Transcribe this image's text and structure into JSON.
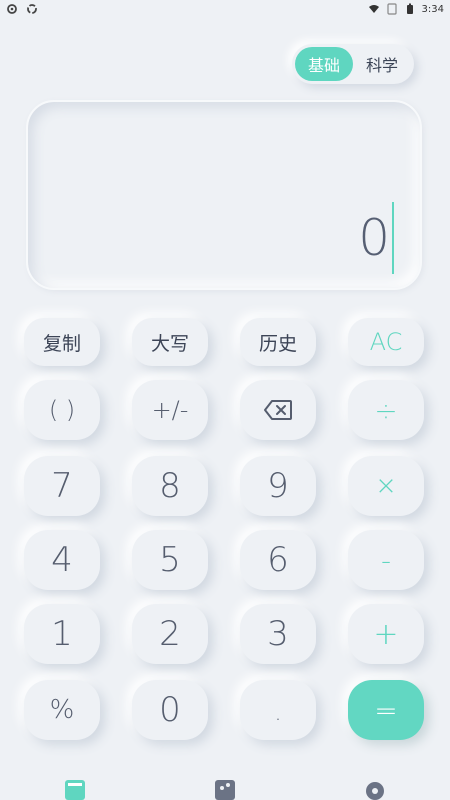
{
  "status": {
    "time": "3:34"
  },
  "mode": {
    "basic": "基础",
    "science": "科学"
  },
  "display": {
    "value": "0"
  },
  "keys": {
    "copy": "复制",
    "uppercase": "大写",
    "history": "历史",
    "clear": "AC",
    "parens": "( )",
    "sign": "+/-",
    "divide": "÷",
    "seven": "7",
    "eight": "8",
    "nine": "9",
    "multiply": "×",
    "four": "4",
    "five": "5",
    "six": "6",
    "minus": "-",
    "one": "1",
    "two": "2",
    "three": "3",
    "plus": "+",
    "percent": "%",
    "zero": "0",
    "dot": ".",
    "equals": "="
  },
  "colors": {
    "accent": "#5fd6c0",
    "background": "#eef1f5",
    "text": "#555d6e"
  },
  "icons": {
    "backspace": "backspace-icon",
    "nav": [
      "calculator-icon",
      "share-icon",
      "settings-icon"
    ]
  }
}
